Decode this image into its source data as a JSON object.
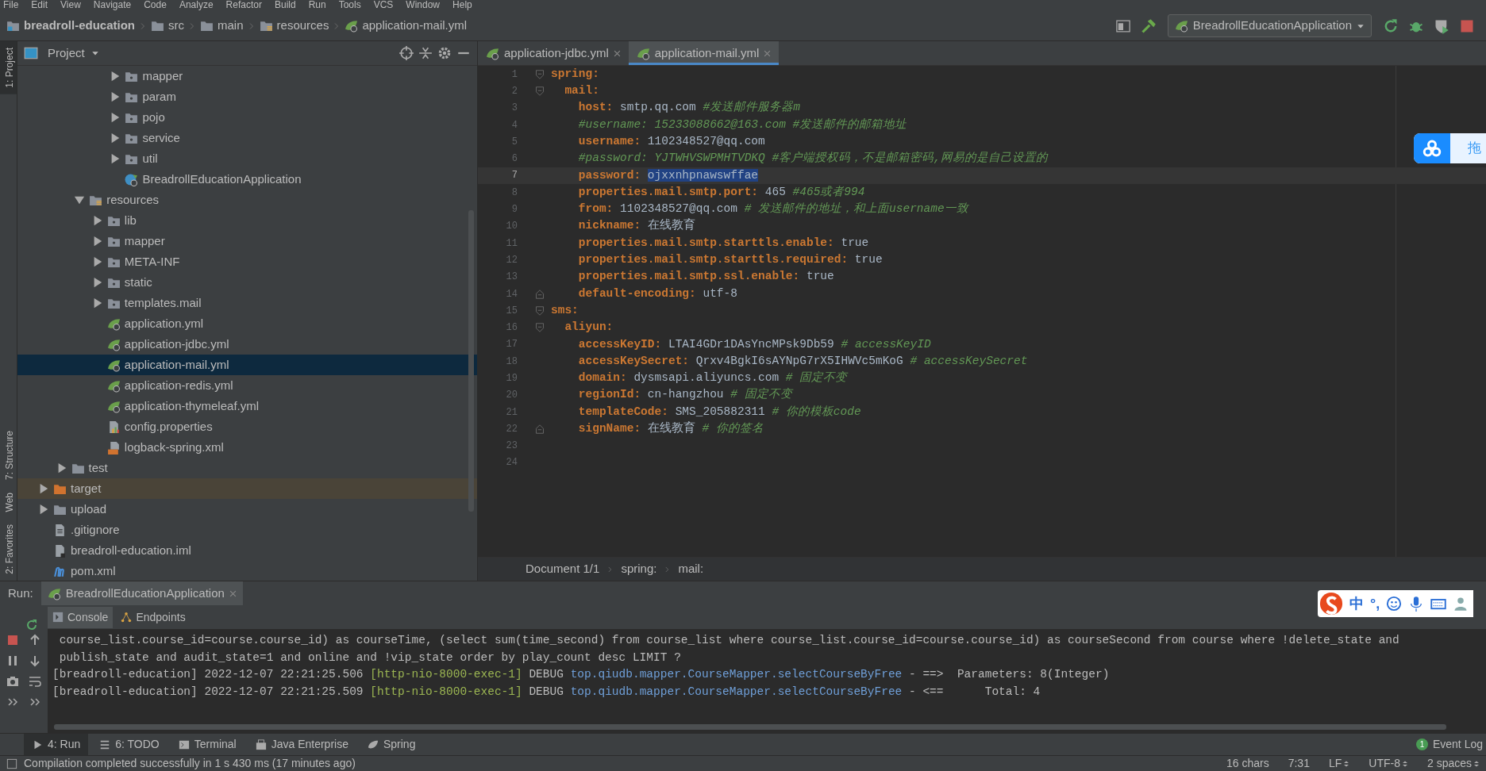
{
  "menu": [
    "File",
    "Edit",
    "View",
    "Navigate",
    "Code",
    "Analyze",
    "Refactor",
    "Build",
    "Run",
    "Tools",
    "VCS",
    "Window",
    "Help"
  ],
  "breadcrumb": [
    {
      "label": "breadroll-education",
      "kind": "project"
    },
    {
      "label": "src",
      "kind": "folder"
    },
    {
      "label": "main",
      "kind": "folder"
    },
    {
      "label": "resources",
      "kind": "resources"
    },
    {
      "label": "application-mail.yml",
      "kind": "yaml"
    }
  ],
  "run_config": "BreadrollEducationApplication",
  "side_tabs_top": [
    {
      "label": "1: Project",
      "selected": true
    },
    {
      "label": "7: Structure",
      "selected": false
    }
  ],
  "side_tabs_bottom": [
    {
      "label": "Web",
      "selected": false
    },
    {
      "label": "2: Favorites",
      "selected": false
    }
  ],
  "project_panel": {
    "title": "Project",
    "tree": [
      {
        "children": [
          {
            "children": [
              {
                "children": [
                  {
                    "children": [
                      {
                        "label": "mapper",
                        "kind": "package",
                        "expanded": false,
                        "selected": false
                      },
                      {
                        "label": "param",
                        "kind": "package",
                        "expanded": false,
                        "selected": false
                      },
                      {
                        "label": "pojo",
                        "kind": "package",
                        "expanded": false,
                        "selected": false
                      },
                      {
                        "label": "service",
                        "kind": "package",
                        "expanded": false,
                        "selected": false
                      },
                      {
                        "label": "util",
                        "kind": "package",
                        "expanded": false,
                        "selected": false
                      },
                      {
                        "label": "BreadrollEducationApplication",
                        "kind": "spring-class",
                        "selected": false
                      }
                    ]
                  }
                ]
              },
              {
                "label": "resources",
                "kind": "resources",
                "expanded": true,
                "selected": false,
                "children": [
                  {
                    "label": "lib",
                    "kind": "package",
                    "expanded": false,
                    "selected": false
                  },
                  {
                    "label": "mapper",
                    "kind": "package",
                    "expanded": false,
                    "selected": false
                  },
                  {
                    "label": "META-INF",
                    "kind": "package",
                    "expanded": false,
                    "selected": false
                  },
                  {
                    "label": "static",
                    "kind": "package",
                    "expanded": false,
                    "selected": false
                  },
                  {
                    "label": "templates.mail",
                    "kind": "package",
                    "expanded": false,
                    "selected": false
                  },
                  {
                    "label": "application.yml",
                    "kind": "yaml",
                    "selected": false
                  },
                  {
                    "label": "application-jdbc.yml",
                    "kind": "yaml",
                    "selected": false
                  },
                  {
                    "label": "application-mail.yml",
                    "kind": "yaml",
                    "selected": true
                  },
                  {
                    "label": "application-redis.yml",
                    "kind": "yaml",
                    "selected": false
                  },
                  {
                    "label": "application-thymeleaf.yml",
                    "kind": "yaml",
                    "selected": false
                  },
                  {
                    "label": "config.properties",
                    "kind": "properties",
                    "selected": false
                  },
                  {
                    "label": "logback-spring.xml",
                    "kind": "xml",
                    "selected": false
                  }
                ]
              }
            ]
          },
          {
            "label": "test",
            "kind": "folder",
            "expanded": false,
            "selected": false
          }
        ]
      },
      {
        "label": "target",
        "kind": "excluded",
        "expanded": false,
        "selected": false
      },
      {
        "label": "upload",
        "kind": "folder",
        "expanded": false,
        "selected": false
      },
      {
        "label": ".gitignore",
        "kind": "file",
        "selected": false
      },
      {
        "label": "breadroll-education.iml",
        "kind": "iml",
        "selected": false
      },
      {
        "label": "pom.xml",
        "kind": "maven",
        "selected": false
      }
    ]
  },
  "editor": {
    "tabs": [
      {
        "label": "application-jdbc.yml",
        "selected": false
      },
      {
        "label": "application-mail.yml",
        "selected": true
      }
    ],
    "lines": [
      {
        "n": "1",
        "fold_start": true,
        "current": false,
        "segments": [
          {
            "kind": "key",
            "text": "spring:"
          }
        ]
      },
      {
        "n": "2",
        "fold_start": true,
        "current": false,
        "segments": [
          {
            "kind": "key",
            "text": "  mail:"
          }
        ]
      },
      {
        "n": "3",
        "current": false,
        "segments": [
          {
            "kind": "key",
            "text": "    host:"
          },
          {
            "kind": "value",
            "text": " smtp.qq.com "
          },
          {
            "kind": "comment",
            "text": "#发送邮件服务器m"
          }
        ]
      },
      {
        "n": "4",
        "current": false,
        "segments": [
          {
            "kind": "comment",
            "text": "    #username: 15233088662@163.com #发送邮件的邮箱地址"
          }
        ]
      },
      {
        "n": "5",
        "current": false,
        "segments": [
          {
            "kind": "key",
            "text": "    username:"
          },
          {
            "kind": "value",
            "text": " 1102348527@qq.com"
          }
        ]
      },
      {
        "n": "6",
        "current": false,
        "segments": [
          {
            "kind": "comment",
            "text": "    #password: YJTWHVSWPMHTVDKQ #客户端授权码，不是邮箱密码,网易的是自己设置的"
          }
        ]
      },
      {
        "n": "7",
        "current": true,
        "segments": [
          {
            "kind": "key",
            "text": "    password: "
          },
          {
            "kind": "selection",
            "text": "ojxxnhpnawswffae"
          }
        ]
      },
      {
        "n": "8",
        "current": false,
        "segments": [
          {
            "kind": "key",
            "text": "    properties.mail.smtp.port:"
          },
          {
            "kind": "value",
            "text": " 465 "
          },
          {
            "kind": "comment",
            "text": "#465或者994"
          }
        ]
      },
      {
        "n": "9",
        "current": false,
        "segments": [
          {
            "kind": "key",
            "text": "    from:"
          },
          {
            "kind": "value",
            "text": " 1102348527@qq.com "
          },
          {
            "kind": "comment",
            "text": "# 发送邮件的地址，和上面username一致"
          }
        ]
      },
      {
        "n": "10",
        "current": false,
        "segments": [
          {
            "kind": "key",
            "text": "    nickname:"
          },
          {
            "kind": "value",
            "text": " 在线教育"
          }
        ]
      },
      {
        "n": "11",
        "current": false,
        "segments": [
          {
            "kind": "key",
            "text": "    properties.mail.smtp.starttls.enable:"
          },
          {
            "kind": "value",
            "text": " true"
          }
        ]
      },
      {
        "n": "12",
        "current": false,
        "segments": [
          {
            "kind": "key",
            "text": "    properties.mail.smtp.starttls.required:"
          },
          {
            "kind": "value",
            "text": " true"
          }
        ]
      },
      {
        "n": "13",
        "current": false,
        "segments": [
          {
            "kind": "key",
            "text": "    properties.mail.smtp.ssl.enable:"
          },
          {
            "kind": "value",
            "text": " true"
          }
        ]
      },
      {
        "n": "14",
        "fold_end": true,
        "current": false,
        "segments": [
          {
            "kind": "key",
            "text": "    default-encoding:"
          },
          {
            "kind": "value",
            "text": " utf-8"
          }
        ]
      },
      {
        "n": "15",
        "fold_start": true,
        "current": false,
        "segments": [
          {
            "kind": "key",
            "text": "sms:"
          }
        ]
      },
      {
        "n": "16",
        "fold_start": true,
        "current": false,
        "segments": [
          {
            "kind": "key",
            "text": "  aliyun:"
          }
        ]
      },
      {
        "n": "17",
        "current": false,
        "segments": [
          {
            "kind": "key",
            "text": "    accessKeyID:"
          },
          {
            "kind": "value",
            "text": " LTAI4GDr1DAsYncMPsk9Db59 "
          },
          {
            "kind": "comment",
            "text": "# accessKeyID"
          }
        ]
      },
      {
        "n": "18",
        "current": false,
        "segments": [
          {
            "kind": "key",
            "text": "    accessKeySecret:"
          },
          {
            "kind": "value",
            "text": " Qrxv4BgkI6sAYNpG7rX5IHWVc5mKoG "
          },
          {
            "kind": "comment",
            "text": "# accessKeySecret"
          }
        ]
      },
      {
        "n": "19",
        "current": false,
        "segments": [
          {
            "kind": "key",
            "text": "    domain:"
          },
          {
            "kind": "value",
            "text": " dysmsapi.aliyuncs.com "
          },
          {
            "kind": "comment",
            "text": "# 固定不变"
          }
        ]
      },
      {
        "n": "20",
        "current": false,
        "segments": [
          {
            "kind": "key",
            "text": "    regionId:"
          },
          {
            "kind": "value",
            "text": " cn-hangzhou "
          },
          {
            "kind": "comment",
            "text": "# 固定不变"
          }
        ]
      },
      {
        "n": "21",
        "current": false,
        "segments": [
          {
            "kind": "key",
            "text": "    templateCode:"
          },
          {
            "kind": "value",
            "text": " SMS_205882311 "
          },
          {
            "kind": "comment",
            "text": "# 你的模板code"
          }
        ]
      },
      {
        "n": "22",
        "fold_end": true,
        "current": false,
        "segments": [
          {
            "kind": "key",
            "text": "    signName:"
          },
          {
            "kind": "value",
            "text": " 在线教育 "
          },
          {
            "kind": "comment",
            "text": "# 你的签名"
          }
        ]
      },
      {
        "n": "23",
        "current": false
      },
      {
        "n": "24",
        "current": false
      }
    ],
    "breadcrumb": [
      "Document 1/1",
      "spring:",
      "mail:"
    ]
  },
  "float_widget": {
    "label": "拖"
  },
  "run_panel": {
    "label": "Run:",
    "tab": "BreadrollEducationApplication",
    "subtabs": [
      {
        "label": "Console",
        "kind": "console",
        "selected": true
      },
      {
        "label": "Endpoints",
        "kind": "endpoints",
        "selected": false
      }
    ],
    "console": [
      [
        {
          "kind": "plain",
          "text": " course_list.course_id=course.course_id) as courseTime, (select sum(time_second) from course_list where course_list.course_id=course.course_id) as courseSecond from course where !delete_state and"
        }
      ],
      [
        {
          "kind": "plain",
          "text": " publish_state and audit_state=1 and online and !vip_state order by play_count desc LIMIT ?"
        }
      ],
      [
        {
          "kind": "plain",
          "text": "[breadroll-education] 2022-12-07 22:21:25.506 "
        },
        {
          "kind": "thread",
          "text": "[http-nio-8000-exec-1]"
        },
        {
          "kind": "plain",
          "text": " DEBUG "
        },
        {
          "kind": "logger",
          "text": "top.qiudb.mapper.CourseMapper.selectCourseByFree"
        },
        {
          "kind": "plain",
          "text": " - ==>  Parameters: 8(Integer)"
        }
      ],
      [
        {
          "kind": "plain",
          "text": "[breadroll-education] 2022-12-07 22:21:25.509 "
        },
        {
          "kind": "thread",
          "text": "[http-nio-8000-exec-1]"
        },
        {
          "kind": "plain",
          "text": " DEBUG "
        },
        {
          "kind": "logger",
          "text": "top.qiudb.mapper.CourseMapper.selectCourseByFree"
        },
        {
          "kind": "plain",
          "text": " - <==      Total: 4"
        }
      ]
    ]
  },
  "ime_toolbar": {
    "items": [
      "中",
      "°,"
    ]
  },
  "tool_windows": [
    {
      "label": "4: Run",
      "kind": "run",
      "selected": true
    },
    {
      "label": "6: TODO",
      "kind": "todo",
      "selected": false
    },
    {
      "label": "Terminal",
      "kind": "terminal",
      "selected": false
    },
    {
      "label": "Java Enterprise",
      "kind": "enterprise",
      "selected": false
    },
    {
      "label": "Spring",
      "kind": "spring",
      "selected": false
    }
  ],
  "event_log": {
    "label": "Event Log",
    "count": "1"
  },
  "status_bar": {
    "message": "Compilation completed successfully in 1 s 430 ms (17 minutes ago)",
    "items": [
      {
        "label": "16 chars",
        "dropdown": false
      },
      {
        "label": "7:31",
        "dropdown": false
      },
      {
        "label": "LF",
        "dropdown": true
      },
      {
        "label": "UTF-8",
        "dropdown": true
      },
      {
        "label": "2 spaces",
        "dropdown": true
      }
    ]
  }
}
